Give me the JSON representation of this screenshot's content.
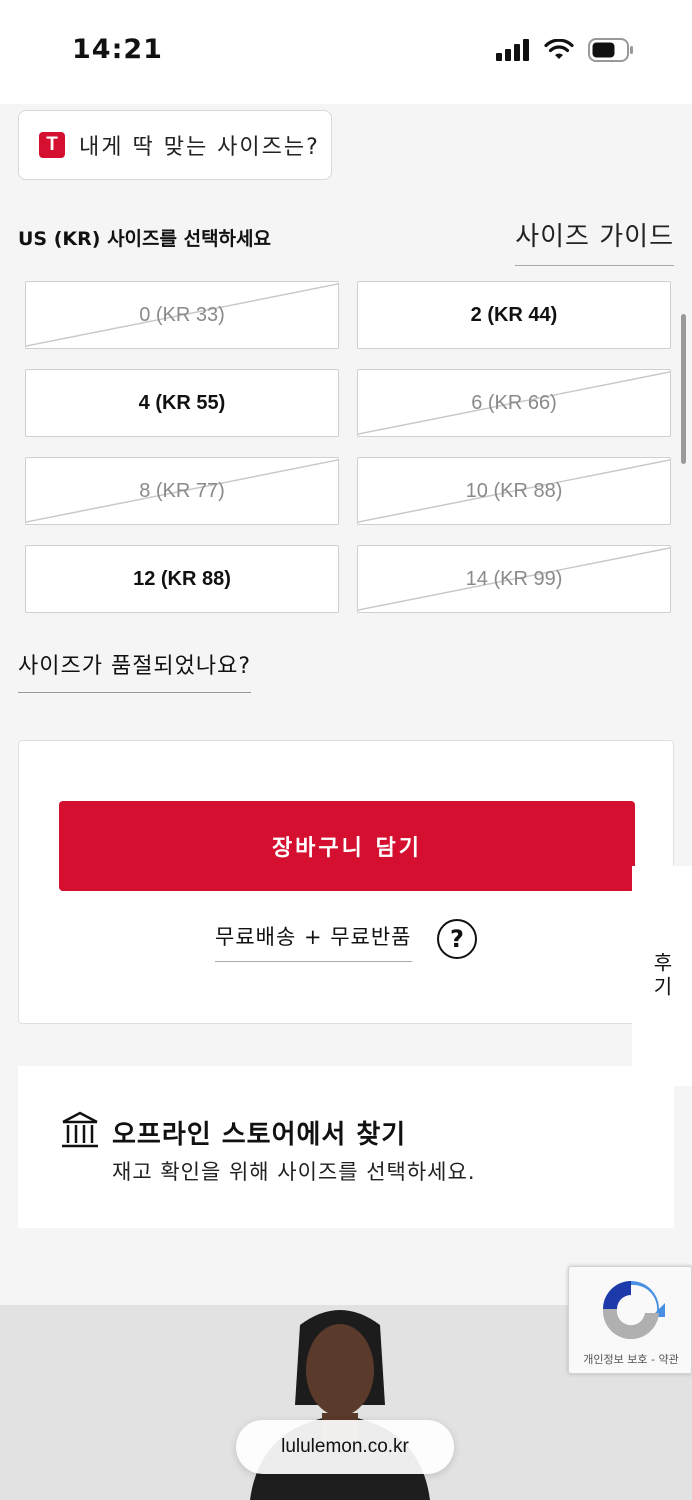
{
  "status_bar": {
    "time": "14:21"
  },
  "fit_button": {
    "logo_letter": "T",
    "label": "내게 딱 맞는 사이즈는?"
  },
  "size_selection": {
    "label": "US (KR) 사이즈를 선택하세요",
    "guide_link": "사이즈 가이드",
    "sizes": [
      {
        "label": "0 (KR 33)",
        "available": false
      },
      {
        "label": "2 (KR 44)",
        "available": true
      },
      {
        "label": "4 (KR 55)",
        "available": true
      },
      {
        "label": "6 (KR 66)",
        "available": false
      },
      {
        "label": "8 (KR 77)",
        "available": false
      },
      {
        "label": "10 (KR 88)",
        "available": false
      },
      {
        "label": "12 (KR 88)",
        "available": true
      },
      {
        "label": "14 (KR 99)",
        "available": false
      }
    ],
    "soldout_link": "사이즈가 품절되었나요?"
  },
  "cart": {
    "add_button": "장바구니 담기",
    "shipping_link": "무료배송 + 무료반품",
    "help_symbol": "?"
  },
  "side_tab": {
    "label": "후기"
  },
  "store": {
    "title": "오프라인 스토어에서 찾기",
    "subtitle": "재고 확인을 위해 사이즈를 선택하세요."
  },
  "recaptcha": {
    "label": "개인정보 보호 - 약관"
  },
  "browser": {
    "url": "lululemon.co.kr"
  },
  "colors": {
    "accent": "#d40f2f",
    "background": "#f5f5f5"
  }
}
